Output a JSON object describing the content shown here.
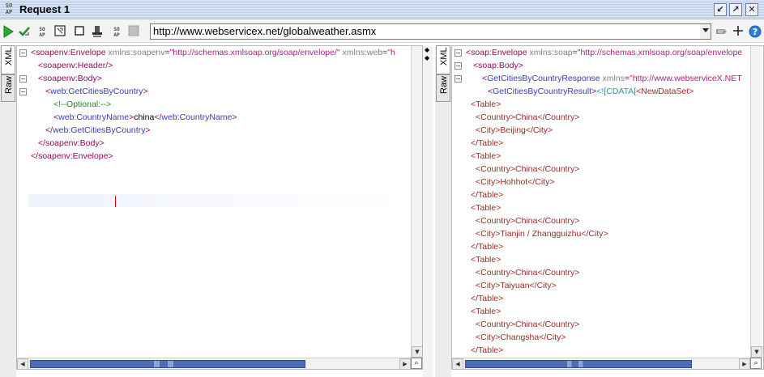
{
  "window": {
    "logo_text": "SOAP",
    "title": "Request 1",
    "controls": [
      "↙",
      "↗",
      "✕"
    ]
  },
  "toolbar": {
    "endpoint_url": "http://www.webservicex.net/globalweather.asmx"
  },
  "request_panel": {
    "tabs": [
      "XML",
      "Raw"
    ],
    "active_tab": "XML",
    "lines": [
      [
        [
          "t-tag",
          "<"
        ],
        [
          "t-tag",
          "soapenv:Envelope"
        ],
        [
          "t-attr",
          " xmlns:soapenv"
        ],
        [
          "t-tag",
          "="
        ],
        [
          "t-val",
          "\"http://schemas.xmlsoap.org/soap/envelope/\""
        ],
        [
          "t-attr",
          " xmlns:web"
        ],
        [
          "t-tag",
          "="
        ],
        [
          "t-val",
          "\"h"
        ]
      ],
      [
        [
          "t-tag",
          "<"
        ],
        [
          "t-tag",
          "soapenv:Header"
        ],
        [
          "t-tag",
          "/>"
        ]
      ],
      [
        [
          "t-tag",
          "<"
        ],
        [
          "t-tag",
          "soapenv:Body"
        ],
        [
          "t-tag",
          ">"
        ]
      ],
      [
        [
          "t-tag",
          "<"
        ],
        [
          "t-name",
          "web:GetCitiesByCountry"
        ],
        [
          "t-tag",
          ">"
        ]
      ],
      [
        [
          "t-comment",
          "<!--Optional:-->"
        ]
      ],
      [
        [
          "t-tag",
          "<"
        ],
        [
          "t-name",
          "web:CountryName"
        ],
        [
          "t-tag",
          ">"
        ],
        [
          "t-text",
          "china"
        ],
        [
          "t-tag",
          "</"
        ],
        [
          "t-name",
          "web:CountryName"
        ],
        [
          "t-tag",
          ">"
        ]
      ],
      [
        [
          "t-tag",
          "</"
        ],
        [
          "t-name",
          "web:GetCitiesByCountry"
        ],
        [
          "t-tag",
          ">"
        ]
      ],
      [
        [
          "t-tag",
          "</"
        ],
        [
          "t-tag",
          "soapenv:Body"
        ],
        [
          "t-tag",
          ">"
        ]
      ],
      [
        [
          "t-tag",
          "</"
        ],
        [
          "t-tag",
          "soapenv:Envelope"
        ],
        [
          "t-tag",
          ">"
        ]
      ]
    ]
  },
  "response_panel": {
    "tabs": [
      "XML",
      "Raw"
    ],
    "active_tab": "XML",
    "lines": [
      [
        [
          "t-tag",
          "<"
        ],
        [
          "t-tag",
          "soap:Envelope"
        ],
        [
          "t-attr",
          " xmlns:soap"
        ],
        [
          "t-tag",
          "="
        ],
        [
          "t-val",
          "\"http://schemas.xmlsoap.org/soap/envelope"
        ]
      ],
      [
        [
          "t-tag",
          "<"
        ],
        [
          "t-tag",
          "soap:Body"
        ],
        [
          "t-tag",
          ">"
        ]
      ],
      [
        [
          "t-tag",
          "<"
        ],
        [
          "t-name",
          "GetCitiesByCountryResponse"
        ],
        [
          "t-attr",
          " xmlns"
        ],
        [
          "t-tag",
          "="
        ],
        [
          "t-val",
          "\"http://www.webserviceX.NET"
        ]
      ],
      [
        [
          "t-tag",
          "<"
        ],
        [
          "t-name",
          "GetCitiesByCountryResult"
        ],
        [
          "t-tag",
          ">"
        ],
        [
          "t-cdata",
          "<![CDATA["
        ],
        [
          "t-data",
          "<NewDataSet>"
        ]
      ],
      [
        [
          "t-data",
          "<Table>"
        ]
      ],
      [
        [
          "t-data",
          "<Country>China</Country>"
        ]
      ],
      [
        [
          "t-data",
          "<City>Beijing</City>"
        ]
      ],
      [
        [
          "t-data",
          "</Table>"
        ]
      ],
      [
        [
          "t-data",
          "<Table>"
        ]
      ],
      [
        [
          "t-data",
          "<Country>China</Country>"
        ]
      ],
      [
        [
          "t-data",
          "<City>Hohhot</City>"
        ]
      ],
      [
        [
          "t-data",
          "</Table>"
        ]
      ],
      [
        [
          "t-data",
          "<Table>"
        ]
      ],
      [
        [
          "t-data",
          "<Country>China</Country>"
        ]
      ],
      [
        [
          "t-data",
          "<City>Tianjin / Zhangguizhu</City>"
        ]
      ],
      [
        [
          "t-data",
          "</Table>"
        ]
      ],
      [
        [
          "t-data",
          "<Table>"
        ]
      ],
      [
        [
          "t-data",
          "<Country>China</Country>"
        ]
      ],
      [
        [
          "t-data",
          "<City>Taiyuan</City>"
        ]
      ],
      [
        [
          "t-data",
          "</Table>"
        ]
      ],
      [
        [
          "t-data",
          "<Table>"
        ]
      ],
      [
        [
          "t-data",
          "<Country>China</Country>"
        ]
      ],
      [
        [
          "t-data",
          "<City>Changsha</City>"
        ]
      ],
      [
        [
          "t-data",
          "</Table>"
        ]
      ]
    ]
  }
}
